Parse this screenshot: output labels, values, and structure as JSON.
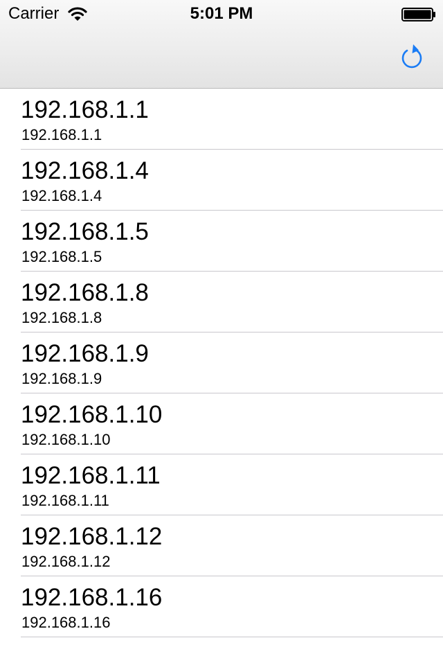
{
  "status_bar": {
    "carrier": "Carrier",
    "time": "5:01 PM",
    "wifi_icon": "wifi-icon",
    "battery_icon": "battery-icon"
  },
  "nav_bar": {
    "refresh_icon": "refresh-icon",
    "accent_color": "#1a7cf5"
  },
  "hosts": [
    {
      "title": "192.168.1.1",
      "subtitle": "192.168.1.1"
    },
    {
      "title": "192.168.1.4",
      "subtitle": "192.168.1.4"
    },
    {
      "title": "192.168.1.5",
      "subtitle": "192.168.1.5"
    },
    {
      "title": "192.168.1.8",
      "subtitle": "192.168.1.8"
    },
    {
      "title": "192.168.1.9",
      "subtitle": "192.168.1.9"
    },
    {
      "title": "192.168.1.10",
      "subtitle": "192.168.1.10"
    },
    {
      "title": "192.168.1.11",
      "subtitle": "192.168.1.11"
    },
    {
      "title": "192.168.1.12",
      "subtitle": "192.168.1.12"
    },
    {
      "title": "192.168.1.16",
      "subtitle": "192.168.1.16"
    }
  ]
}
